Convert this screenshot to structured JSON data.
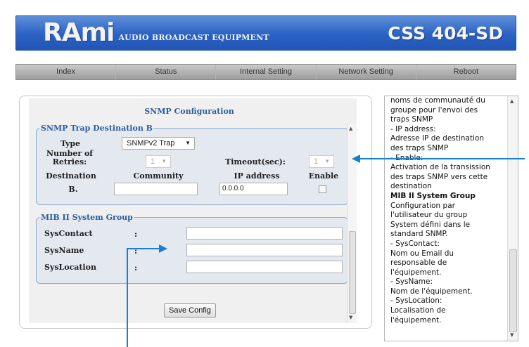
{
  "header": {
    "logo": "RAmi",
    "tagline": "AUDIO BROADCAST EQUIPMENT",
    "product": "CSS 404-SD",
    "bg_color": "#2b62c4"
  },
  "nav": {
    "items": [
      {
        "label": "Index"
      },
      {
        "label": "Status"
      },
      {
        "label": "Internal Setting"
      },
      {
        "label": "Network Setting"
      },
      {
        "label": "Reboot"
      }
    ]
  },
  "main": {
    "title": "SNMP Configuration",
    "trap": {
      "legend": "SNMP Trap Destination B",
      "type_label": "Type",
      "type_value": "SNMPv2 Trap",
      "retries_label": "Number of Retries:",
      "retries_value": "1",
      "timeout_label": "Timeout(sec):",
      "timeout_value": "1",
      "destination_header": "Destination",
      "community_header": "Community",
      "ip_header": "IP address",
      "enable_header": "Enable",
      "row_label": "B.",
      "community_value": "",
      "ip_value": "0.0.0.0",
      "enabled": false
    },
    "mib": {
      "legend": "MIB II System Group",
      "contact_label": "SysContact",
      "name_label": "SysName",
      "location_label": "SysLocation",
      "colon": ":",
      "contact_value": "",
      "name_value": "",
      "location_value": ""
    },
    "save_label": "Save Config"
  },
  "help": {
    "lines": [
      "noms de communauté du",
      "groupe pour l'envoi des",
      "traps SNMP",
      "- IP address:",
      "Adresse IP de destination",
      "des traps SNMP",
      "- Enable:",
      "Activation de la transission",
      "des traps SNMP vers cette",
      "destination",
      "MIB II System Group",
      "Configuration par",
      "l'utilisateur du group",
      "System défini dans le",
      "standard SNMP.",
      "- SysContact:",
      "Nom ou Email du",
      "responsable de",
      "l'équipement.",
      "- SysName:",
      "Nom de l'équipement.",
      "- SysLocation:",
      "Localisation de",
      "l'équipement."
    ],
    "bold_line": "MIB II System Group"
  },
  "colors": {
    "accent": "#2e5f9e",
    "annotation_arrow": "#1a7fd1"
  },
  "icons": {
    "dropdown": "chevron-down-icon",
    "scroll_up": "arrow-up-icon",
    "scroll_down": "arrow-down-icon"
  }
}
